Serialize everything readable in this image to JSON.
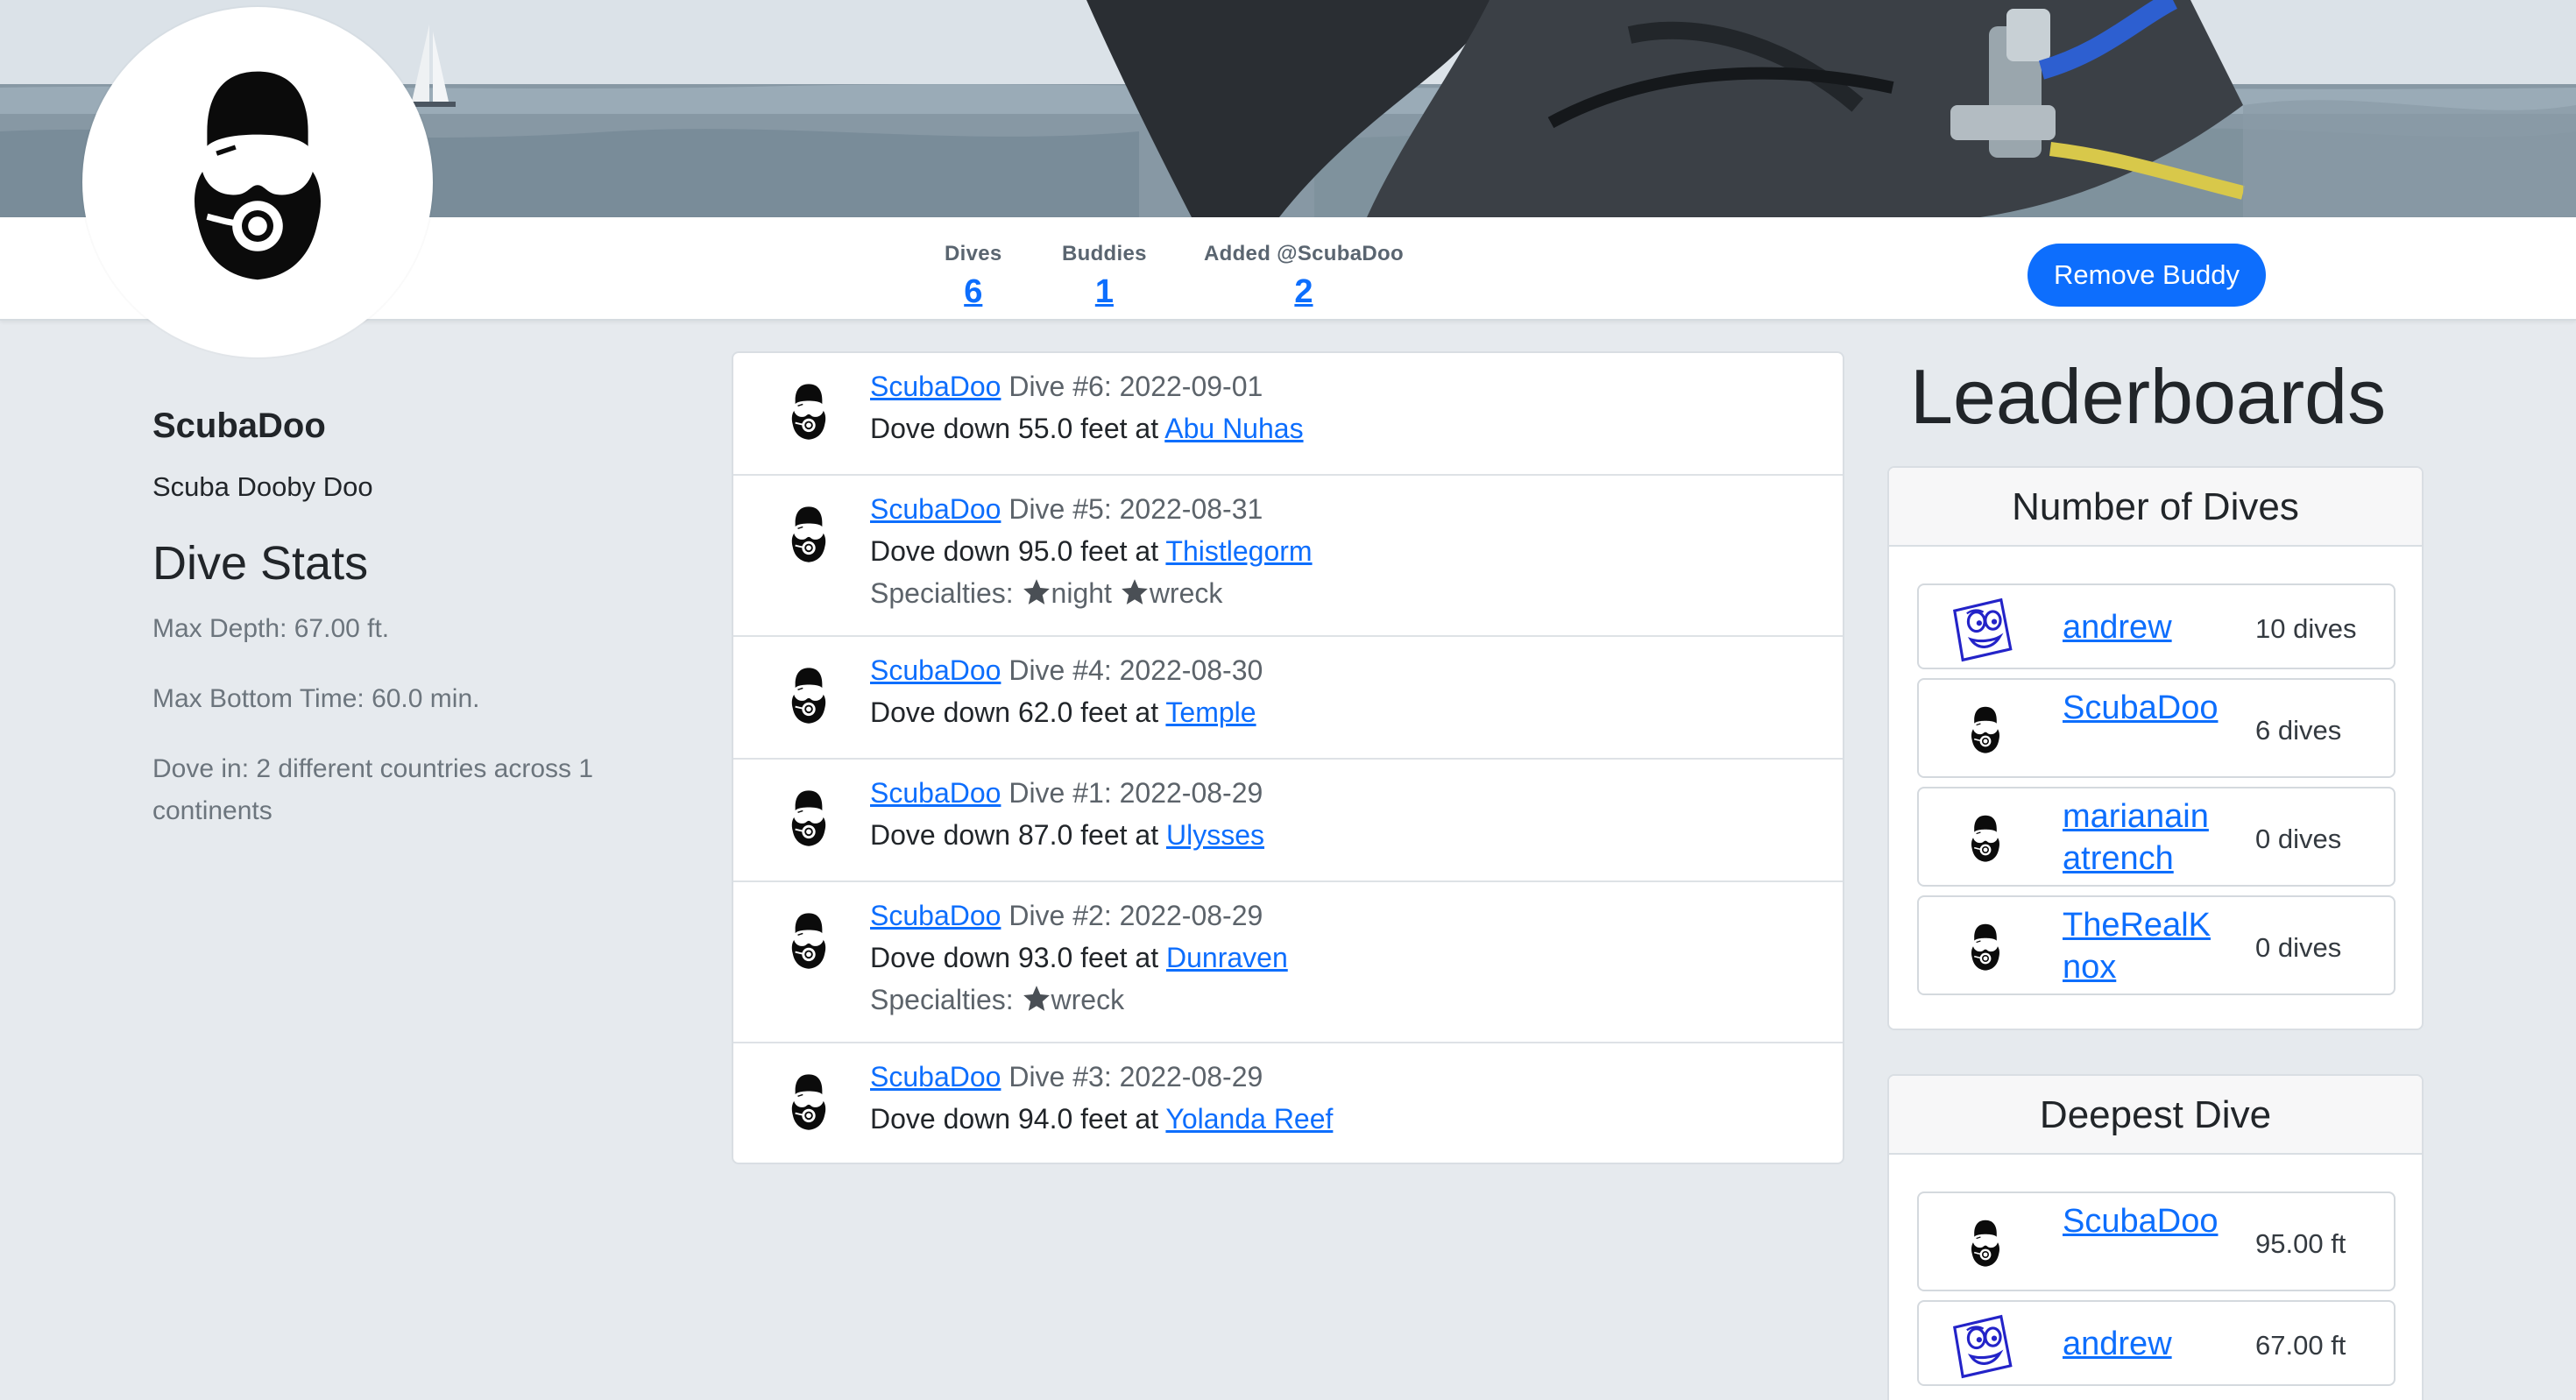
{
  "stats": {
    "dives_label": "Dives",
    "dives_value": "6",
    "buddies_label": "Buddies",
    "buddies_value": "1",
    "added_label": "Added @ScubaDoo",
    "added_value": "2"
  },
  "remove_buddy_label": "Remove Buddy",
  "profile": {
    "username": "ScubaDoo",
    "full_name": "Scuba Dooby Doo",
    "stats_heading": "Dive Stats",
    "max_depth": "Max Depth: 67.00 ft.",
    "max_bottom_time": "Max Bottom Time: 60.0 min.",
    "dove_in": "Dove in: 2 different countries across 1 continents"
  },
  "dives": [
    {
      "user": "ScubaDoo",
      "title": " Dive #6: 2022-09-01",
      "depth": "Dove down 55.0 feet at ",
      "site": "Abu Nuhas",
      "specialties": ""
    },
    {
      "user": "ScubaDoo",
      "title": " Dive #5: 2022-08-31",
      "depth": "Dove down 95.0 feet at ",
      "site": "Thistlegorm",
      "specialties_label": "Specialties: ",
      "specialty_1": "night",
      "specialty_2": "wreck"
    },
    {
      "user": "ScubaDoo",
      "title": " Dive #4: 2022-08-30",
      "depth": "Dove down 62.0 feet at ",
      "site": "Temple"
    },
    {
      "user": "ScubaDoo",
      "title": " Dive #1: 2022-08-29",
      "depth": "Dove down 87.0 feet at ",
      "site": "Ulysses"
    },
    {
      "user": "ScubaDoo",
      "title": " Dive #2: 2022-08-29",
      "depth": "Dove down 93.0 feet at ",
      "site": "Dunraven",
      "specialties_label": "Specialties: ",
      "specialty_1": "wreck"
    },
    {
      "user": "ScubaDoo",
      "title": " Dive #3: 2022-08-29",
      "depth": "Dove down 94.0 feet at ",
      "site": "Yolanda Reef"
    }
  ],
  "leaderboards": {
    "title": "Leaderboards",
    "number_of_dives": {
      "heading": "Number of Dives",
      "rows": [
        {
          "name": "andrew",
          "value": "10 dives",
          "icon": "cartoon-face-icon"
        },
        {
          "name": "ScubaDoo",
          "value": "6 dives",
          "icon": "diver-mask-icon"
        },
        {
          "name": "marianainatrench",
          "value": "0 dives",
          "icon": "diver-mask-icon"
        },
        {
          "name": "TheRealKnox",
          "value": "0 dives",
          "icon": "diver-mask-icon"
        }
      ]
    },
    "deepest_dive": {
      "heading": "Deepest Dive",
      "rows": [
        {
          "name": "ScubaDoo",
          "value": "95.00 ft",
          "icon": "diver-mask-icon"
        },
        {
          "name": "andrew",
          "value": "67.00 ft",
          "icon": "cartoon-face-icon"
        }
      ]
    }
  },
  "colors": {
    "link": "#0d6efd",
    "page_bg": "#e6eaee",
    "button": "#0d6efd"
  }
}
